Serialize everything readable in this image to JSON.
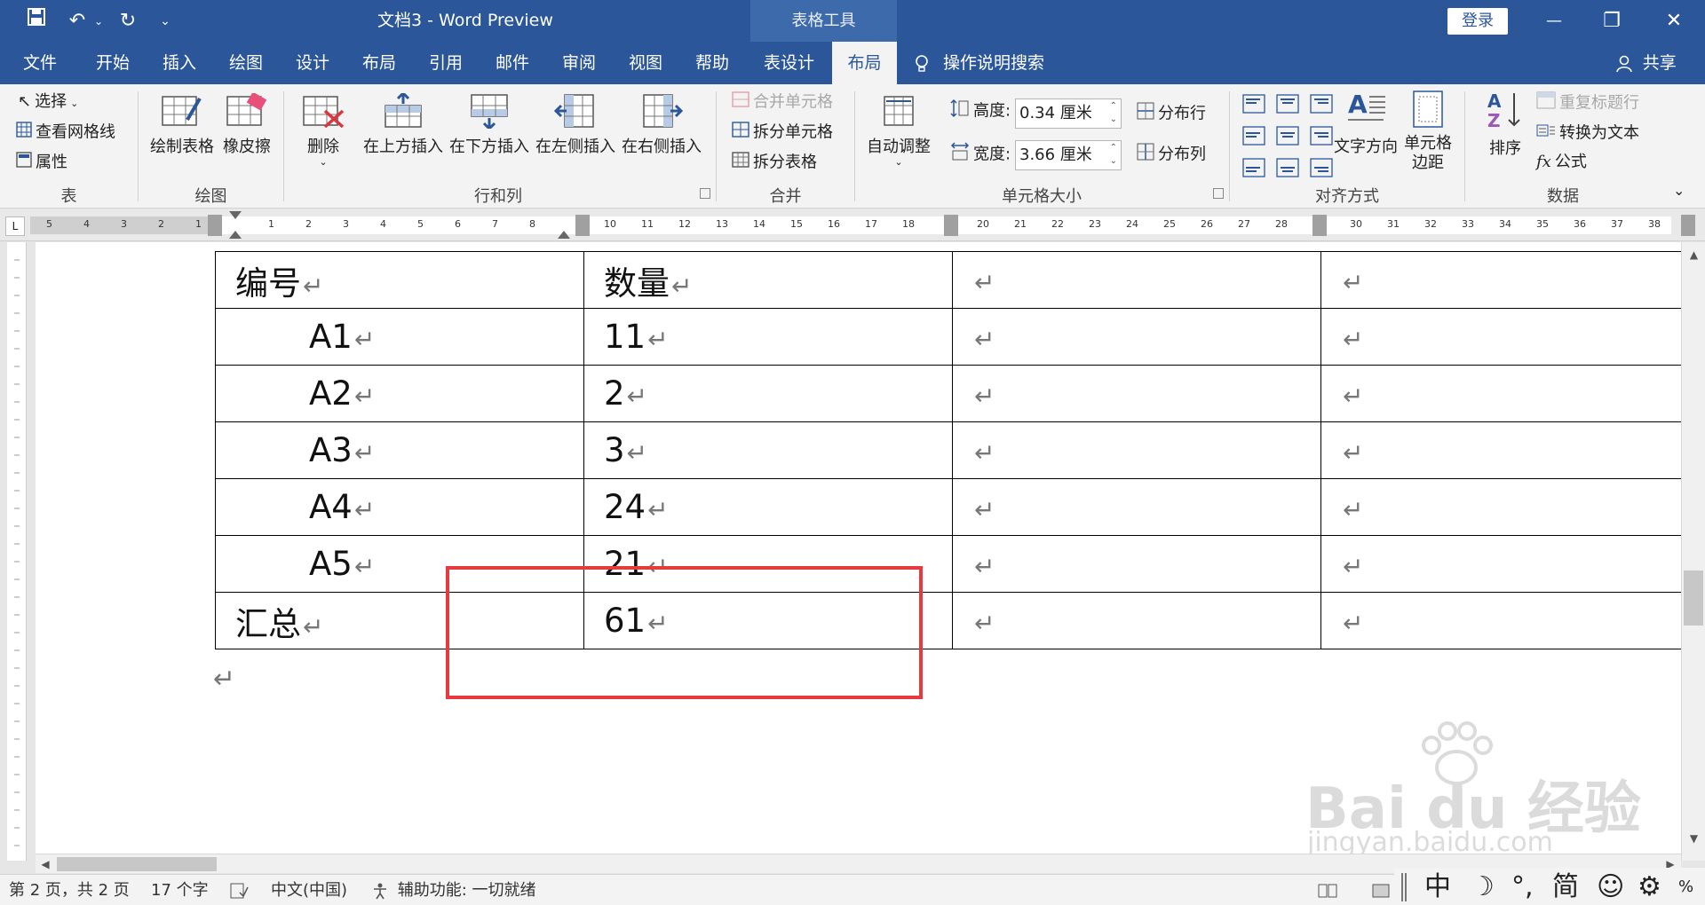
{
  "titlebar": {
    "title": "文档3  -  Word Preview",
    "tools_context": "表格工具",
    "login": "登录",
    "minimize": "—",
    "restore": "❐",
    "close": "✕"
  },
  "tabs": {
    "file": "文件",
    "home": "开始",
    "insert": "插入",
    "draw": "绘图",
    "design": "设计",
    "layout": "布局",
    "references": "引用",
    "mailings": "邮件",
    "review": "审阅",
    "view": "视图",
    "help": "帮助",
    "table_design": "表设计",
    "table_layout": "布局",
    "search": "操作说明搜索",
    "share": "共享"
  },
  "ribbon": {
    "groups": {
      "table": {
        "label": "表",
        "select": "选择",
        "gridlines": "查看网格线",
        "properties": "属性"
      },
      "draw": {
        "label": "绘图",
        "draw_table": "绘制表格",
        "eraser": "橡皮擦"
      },
      "rows_cols": {
        "label": "行和列",
        "delete": "删除",
        "insert_above": "在上方插入",
        "insert_below": "在下方插入",
        "insert_left": "在左侧插入",
        "insert_right": "在右侧插入"
      },
      "merge": {
        "label": "合并",
        "merge_cells": "合并单元格",
        "split_cells": "拆分单元格",
        "split_table": "拆分表格"
      },
      "cell_size": {
        "label": "单元格大小",
        "autofit": "自动调整",
        "height_label": "高度:",
        "height_value": "0.34 厘米",
        "width_label": "宽度:",
        "width_value": "3.66 厘米",
        "distribute_rows": "分布行",
        "distribute_cols": "分布列"
      },
      "alignment": {
        "label": "对齐方式",
        "text_direction": "文字方向",
        "cell_margins_1": "单元格",
        "cell_margins_2": "边距"
      },
      "data": {
        "label": "数据",
        "sort": "排序",
        "repeat_header": "重复标题行",
        "convert_text": "转换为文本",
        "formula": "公式"
      }
    }
  },
  "ruler": {
    "corner": "L",
    "ticks": [
      "5",
      "4",
      "3",
      "2",
      "1",
      "1",
      "2",
      "3",
      "4",
      "5",
      "6",
      "7",
      "8",
      "10",
      "11",
      "12",
      "13",
      "14",
      "15",
      "16",
      "17",
      "18",
      "20",
      "21",
      "22",
      "23",
      "24",
      "25",
      "26",
      "27",
      "28",
      "30",
      "31",
      "32",
      "33",
      "34",
      "35",
      "36",
      "37",
      "38"
    ]
  },
  "table": {
    "rows": [
      [
        "编号",
        "数量",
        "",
        ""
      ],
      [
        "A1",
        "11",
        "",
        ""
      ],
      [
        "A2",
        "2",
        "",
        ""
      ],
      [
        "A3",
        "3",
        "",
        ""
      ],
      [
        "A4",
        "24",
        "",
        ""
      ],
      [
        "A5",
        "21",
        "",
        ""
      ],
      [
        "汇总",
        "61",
        "",
        ""
      ]
    ],
    "return_mark": "↵"
  },
  "watermark": {
    "text": "Bai du 经验",
    "url": "jingyan.baidu.com"
  },
  "statusbar": {
    "page": "第 2 页，共 2 页",
    "words": "17 个字",
    "language": "中文(中国)",
    "accessibility": "辅助功能: 一切就绪",
    "zoom": "%"
  },
  "ime": {
    "chinese": "中",
    "moon": "☽",
    "punct": "°,",
    "simplified": "简",
    "emoji": "☺",
    "settings": "⚙"
  },
  "colors": {
    "brand": "#2b579a",
    "highlight_box": "#e8393f"
  }
}
